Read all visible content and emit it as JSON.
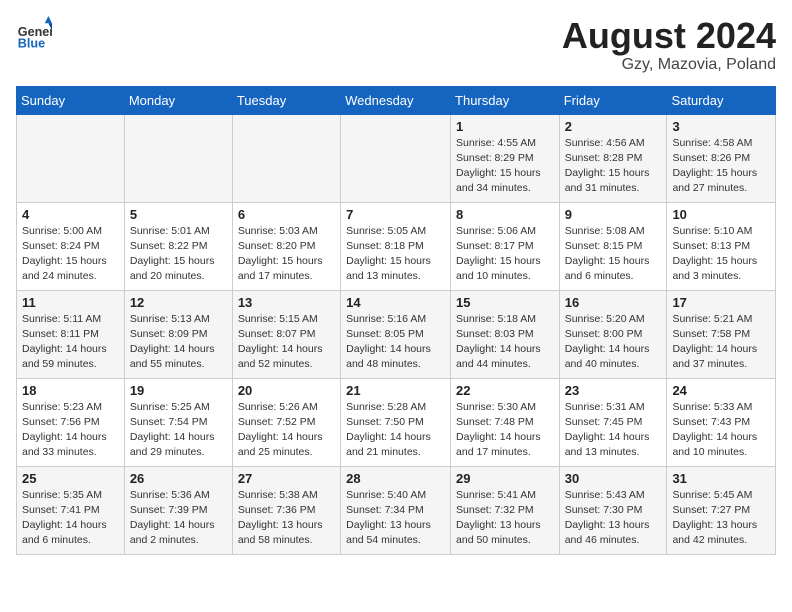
{
  "header": {
    "logo_general": "General",
    "logo_blue": "Blue",
    "month_year": "August 2024",
    "location": "Gzy, Mazovia, Poland"
  },
  "weekdays": [
    "Sunday",
    "Monday",
    "Tuesday",
    "Wednesday",
    "Thursday",
    "Friday",
    "Saturday"
  ],
  "weeks": [
    [
      {
        "day": "",
        "info": ""
      },
      {
        "day": "",
        "info": ""
      },
      {
        "day": "",
        "info": ""
      },
      {
        "day": "",
        "info": ""
      },
      {
        "day": "1",
        "info": "Sunrise: 4:55 AM\nSunset: 8:29 PM\nDaylight: 15 hours\nand 34 minutes."
      },
      {
        "day": "2",
        "info": "Sunrise: 4:56 AM\nSunset: 8:28 PM\nDaylight: 15 hours\nand 31 minutes."
      },
      {
        "day": "3",
        "info": "Sunrise: 4:58 AM\nSunset: 8:26 PM\nDaylight: 15 hours\nand 27 minutes."
      }
    ],
    [
      {
        "day": "4",
        "info": "Sunrise: 5:00 AM\nSunset: 8:24 PM\nDaylight: 15 hours\nand 24 minutes."
      },
      {
        "day": "5",
        "info": "Sunrise: 5:01 AM\nSunset: 8:22 PM\nDaylight: 15 hours\nand 20 minutes."
      },
      {
        "day": "6",
        "info": "Sunrise: 5:03 AM\nSunset: 8:20 PM\nDaylight: 15 hours\nand 17 minutes."
      },
      {
        "day": "7",
        "info": "Sunrise: 5:05 AM\nSunset: 8:18 PM\nDaylight: 15 hours\nand 13 minutes."
      },
      {
        "day": "8",
        "info": "Sunrise: 5:06 AM\nSunset: 8:17 PM\nDaylight: 15 hours\nand 10 minutes."
      },
      {
        "day": "9",
        "info": "Sunrise: 5:08 AM\nSunset: 8:15 PM\nDaylight: 15 hours\nand 6 minutes."
      },
      {
        "day": "10",
        "info": "Sunrise: 5:10 AM\nSunset: 8:13 PM\nDaylight: 15 hours\nand 3 minutes."
      }
    ],
    [
      {
        "day": "11",
        "info": "Sunrise: 5:11 AM\nSunset: 8:11 PM\nDaylight: 14 hours\nand 59 minutes."
      },
      {
        "day": "12",
        "info": "Sunrise: 5:13 AM\nSunset: 8:09 PM\nDaylight: 14 hours\nand 55 minutes."
      },
      {
        "day": "13",
        "info": "Sunrise: 5:15 AM\nSunset: 8:07 PM\nDaylight: 14 hours\nand 52 minutes."
      },
      {
        "day": "14",
        "info": "Sunrise: 5:16 AM\nSunset: 8:05 PM\nDaylight: 14 hours\nand 48 minutes."
      },
      {
        "day": "15",
        "info": "Sunrise: 5:18 AM\nSunset: 8:03 PM\nDaylight: 14 hours\nand 44 minutes."
      },
      {
        "day": "16",
        "info": "Sunrise: 5:20 AM\nSunset: 8:00 PM\nDaylight: 14 hours\nand 40 minutes."
      },
      {
        "day": "17",
        "info": "Sunrise: 5:21 AM\nSunset: 7:58 PM\nDaylight: 14 hours\nand 37 minutes."
      }
    ],
    [
      {
        "day": "18",
        "info": "Sunrise: 5:23 AM\nSunset: 7:56 PM\nDaylight: 14 hours\nand 33 minutes."
      },
      {
        "day": "19",
        "info": "Sunrise: 5:25 AM\nSunset: 7:54 PM\nDaylight: 14 hours\nand 29 minutes."
      },
      {
        "day": "20",
        "info": "Sunrise: 5:26 AM\nSunset: 7:52 PM\nDaylight: 14 hours\nand 25 minutes."
      },
      {
        "day": "21",
        "info": "Sunrise: 5:28 AM\nSunset: 7:50 PM\nDaylight: 14 hours\nand 21 minutes."
      },
      {
        "day": "22",
        "info": "Sunrise: 5:30 AM\nSunset: 7:48 PM\nDaylight: 14 hours\nand 17 minutes."
      },
      {
        "day": "23",
        "info": "Sunrise: 5:31 AM\nSunset: 7:45 PM\nDaylight: 14 hours\nand 13 minutes."
      },
      {
        "day": "24",
        "info": "Sunrise: 5:33 AM\nSunset: 7:43 PM\nDaylight: 14 hours\nand 10 minutes."
      }
    ],
    [
      {
        "day": "25",
        "info": "Sunrise: 5:35 AM\nSunset: 7:41 PM\nDaylight: 14 hours\nand 6 minutes."
      },
      {
        "day": "26",
        "info": "Sunrise: 5:36 AM\nSunset: 7:39 PM\nDaylight: 14 hours\nand 2 minutes."
      },
      {
        "day": "27",
        "info": "Sunrise: 5:38 AM\nSunset: 7:36 PM\nDaylight: 13 hours\nand 58 minutes."
      },
      {
        "day": "28",
        "info": "Sunrise: 5:40 AM\nSunset: 7:34 PM\nDaylight: 13 hours\nand 54 minutes."
      },
      {
        "day": "29",
        "info": "Sunrise: 5:41 AM\nSunset: 7:32 PM\nDaylight: 13 hours\nand 50 minutes."
      },
      {
        "day": "30",
        "info": "Sunrise: 5:43 AM\nSunset: 7:30 PM\nDaylight: 13 hours\nand 46 minutes."
      },
      {
        "day": "31",
        "info": "Sunrise: 5:45 AM\nSunset: 7:27 PM\nDaylight: 13 hours\nand 42 minutes."
      }
    ]
  ]
}
